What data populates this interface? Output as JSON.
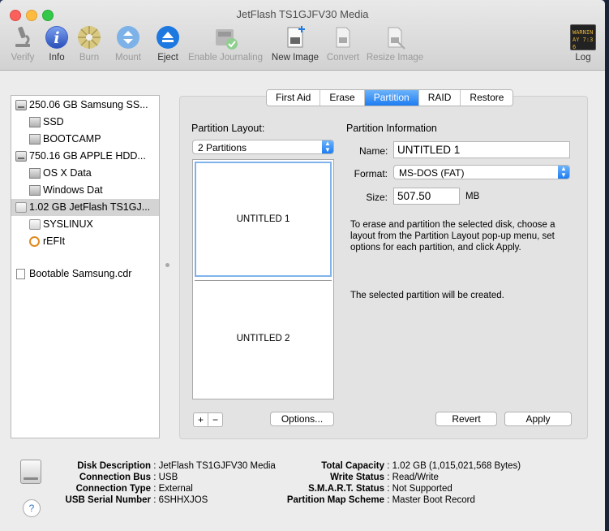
{
  "window": {
    "title": "JetFlash TS1GJFV30 Media"
  },
  "toolbar": [
    {
      "label": "Verify",
      "icon": "microscope-icon",
      "enabled": false
    },
    {
      "label": "Info",
      "icon": "info-icon",
      "enabled": true
    },
    {
      "label": "Burn",
      "icon": "burn-disc-icon",
      "enabled": false
    },
    {
      "label": "Mount",
      "icon": "mount-icon",
      "enabled": false
    },
    {
      "label": "Eject",
      "icon": "eject-icon",
      "enabled": true
    },
    {
      "label": "Enable Journaling",
      "icon": "journaling-icon",
      "enabled": false
    },
    {
      "label": "New Image",
      "icon": "new-image-icon",
      "enabled": true
    },
    {
      "label": "Convert",
      "icon": "convert-icon",
      "enabled": false
    },
    {
      "label": "Resize Image",
      "icon": "resize-image-icon",
      "enabled": false
    },
    {
      "label": "Log",
      "icon": "log-icon",
      "enabled": true,
      "screen_text": "WARNIN AY 7:36"
    }
  ],
  "sidebar": {
    "items": [
      {
        "label": "250.06 GB Samsung SS...",
        "type": "disk",
        "level": 0
      },
      {
        "label": "SSD",
        "type": "volume",
        "level": 1
      },
      {
        "label": "BOOTCAMP",
        "type": "volume",
        "level": 1
      },
      {
        "label": "750.16 GB APPLE HDD...",
        "type": "disk",
        "level": 0
      },
      {
        "label": "OS X Data",
        "type": "volume",
        "level": 1
      },
      {
        "label": "Windows Dat",
        "type": "volume",
        "level": 1
      },
      {
        "label": "1.02 GB JetFlash TS1GJ...",
        "type": "usb",
        "level": 0,
        "selected": true
      },
      {
        "label": "SYSLINUX",
        "type": "usbvol",
        "level": 1
      },
      {
        "label": "rEFIt",
        "type": "refit",
        "level": 1
      },
      {
        "label": "Bootable Samsung.cdr",
        "type": "file",
        "level": 0
      }
    ]
  },
  "tabs": [
    {
      "label": "First Aid",
      "active": false
    },
    {
      "label": "Erase",
      "active": false
    },
    {
      "label": "Partition",
      "active": true
    },
    {
      "label": "RAID",
      "active": false
    },
    {
      "label": "Restore",
      "active": false
    }
  ],
  "partition": {
    "layout_label": "Partition Layout:",
    "layout_value": "2 Partitions",
    "partitions": [
      "UNTITLED 1",
      "UNTITLED 2"
    ],
    "add_label": "+",
    "remove_label": "−",
    "options_label": "Options...",
    "info_heading": "Partition Information",
    "name_label": "Name:",
    "name_value": "UNTITLED 1",
    "format_label": "Format:",
    "format_value": "MS-DOS (FAT)",
    "size_label": "Size:",
    "size_value": "507.50",
    "size_unit": "MB",
    "help_text": "To erase and partition the selected disk, choose a layout from the Partition Layout pop-up menu, set options for each partition, and click Apply.",
    "status_text": "The selected partition will be created.",
    "revert_label": "Revert",
    "apply_label": "Apply"
  },
  "disk_info": {
    "left": [
      {
        "key": "Disk Description",
        "value": "JetFlash TS1GJFV30 Media"
      },
      {
        "key": "Connection Bus",
        "value": "USB"
      },
      {
        "key": "Connection Type",
        "value": "External"
      },
      {
        "key": "USB Serial Number",
        "value": "6SHHXJOS"
      }
    ],
    "right": [
      {
        "key": "Total Capacity",
        "value": "1.02 GB (1,015,021,568 Bytes)"
      },
      {
        "key": "Write Status",
        "value": "Read/Write"
      },
      {
        "key": "S.M.A.R.T. Status",
        "value": "Not Supported"
      },
      {
        "key": "Partition Map Scheme",
        "value": "Master Boot Record"
      }
    ],
    "help_label": "?"
  }
}
